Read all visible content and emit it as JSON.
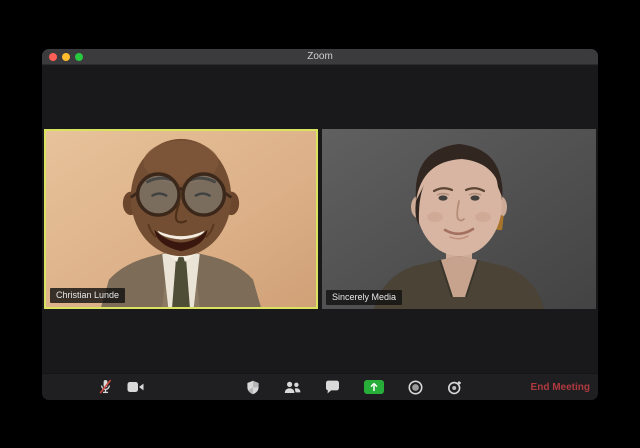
{
  "window": {
    "title": "Zoom",
    "traffic_lights": [
      "close",
      "minimize",
      "zoom"
    ]
  },
  "video_grid": {
    "tiles": [
      {
        "name": "Christian Lunde",
        "active_speaker": true,
        "description": "smiling bald man with round glasses, tweed blazer and tie, peach background"
      },
      {
        "name": "Sincerely Media",
        "active_speaker": false,
        "description": "woman with short dark hair, olive top, gray background"
      }
    ]
  },
  "toolbar": {
    "left_buttons": [
      {
        "icon": "microphone-muted-icon",
        "state": "muted"
      },
      {
        "icon": "video-camera-icon",
        "state": "on"
      }
    ],
    "center_buttons": [
      {
        "icon": "shield-security-icon"
      },
      {
        "icon": "participants-icon"
      },
      {
        "icon": "chat-bubble-icon"
      },
      {
        "icon": "share-screen-up-arrow-icon",
        "highlight": true
      },
      {
        "icon": "record-icon"
      },
      {
        "icon": "stopwatch-icon"
      }
    ],
    "end_meeting_label": "End Meeting"
  },
  "colors": {
    "share_screen_green": "#27ae38",
    "end_meeting_red": "#b03a40",
    "active_speaker_border": "#d9e35f",
    "traffic_red": "#ff5f57",
    "traffic_yellow": "#febc2e",
    "traffic_green": "#28c840",
    "titlebar_gray": "#3b3b3d",
    "window_background": "#19191b"
  }
}
